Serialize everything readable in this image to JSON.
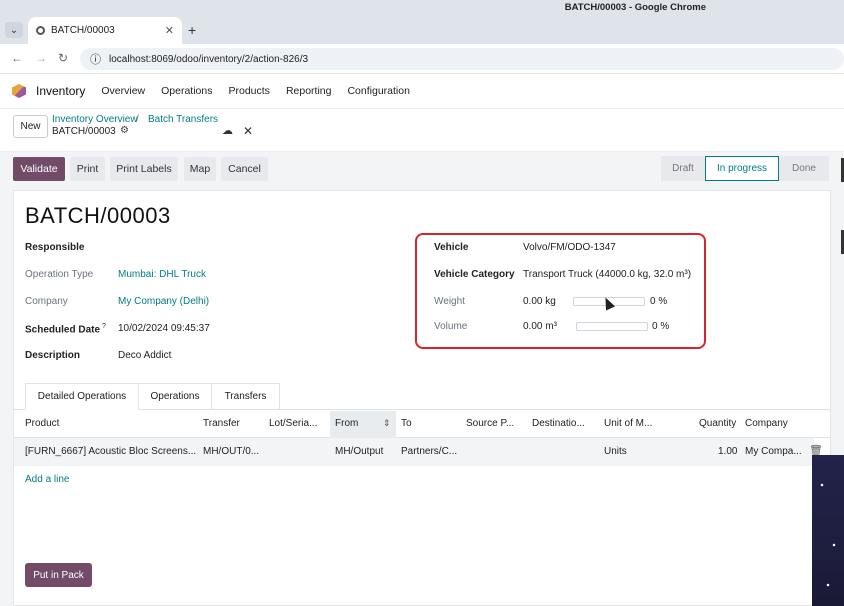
{
  "browser": {
    "window_title": "BATCH/00003 - Google Chrome",
    "tab_title": "BATCH/00003",
    "url": "localhost:8069/odoo/inventory/2/action-826/3"
  },
  "nav": {
    "app": "Inventory",
    "menu": [
      "Overview",
      "Operations",
      "Products",
      "Reporting",
      "Configuration"
    ]
  },
  "control": {
    "new_label": "New",
    "breadcrumb": [
      "Inventory Overview",
      "Batch Transfers"
    ],
    "breadcrumb_sep": "/",
    "record": "BATCH/00003"
  },
  "actions": [
    "Validate",
    "Print",
    "Print Labels",
    "Map",
    "Cancel"
  ],
  "statusbar": [
    "Draft",
    "In progress",
    "Done"
  ],
  "form": {
    "title": "BATCH/00003",
    "left": [
      {
        "label": "Responsible",
        "value": ""
      },
      {
        "label": "Operation Type",
        "value": "Mumbai: DHL Truck"
      },
      {
        "label": "Company",
        "value": "My Company (Delhi)"
      },
      {
        "label": "Scheduled Date",
        "help": "?",
        "value": "10/02/2024 09:45:37"
      },
      {
        "label": "Description",
        "value": "Deco Addict"
      }
    ],
    "right": [
      {
        "label": "Vehicle",
        "value": "Volvo/FM/ODO-1347"
      },
      {
        "label": "Vehicle Category",
        "value": "Transport Truck (44000.0 kg, 32.0 m³)"
      },
      {
        "label": "Weight",
        "value": "0.00 kg",
        "percent": "0 %",
        "level": 0
      },
      {
        "label": "Volume",
        "value": "0.00 m³",
        "percent": "0 %",
        "level": 0
      }
    ]
  },
  "tabs": [
    "Detailed Operations",
    "Operations",
    "Transfers"
  ],
  "table": {
    "headers": [
      "Product",
      "Transfer",
      "Lot/Seria...",
      "From",
      "To",
      "Source P...",
      "Destinatio...",
      "Unit of M...",
      "Quantity",
      "Company"
    ],
    "rows": [
      [
        "[FURN_6667] Acoustic Bloc Screens...",
        "MH/OUT/0...",
        "",
        "MH/Output",
        "Partners/C...",
        "",
        "",
        "Units",
        "1.00",
        "My Compa..."
      ]
    ],
    "add_line": "Add a line"
  },
  "footer_button": "Put in Pack",
  "colors": {
    "primary": "#714b67",
    "link": "#017e84",
    "highlight_box": "#d9232d"
  }
}
